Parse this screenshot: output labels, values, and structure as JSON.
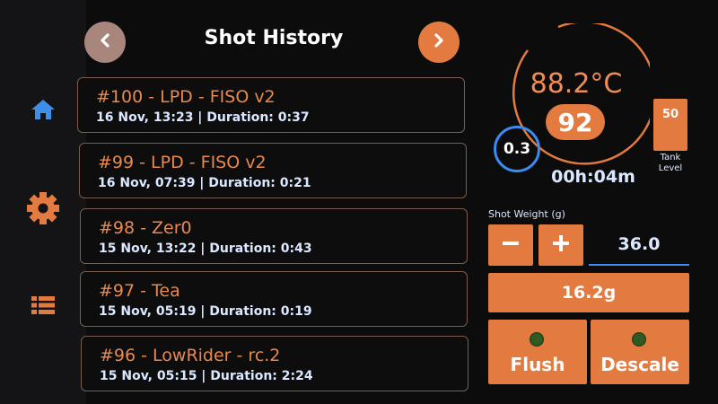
{
  "header": {
    "title": "Shot History"
  },
  "sidebar": {
    "items": [
      {
        "icon": "home-icon"
      },
      {
        "icon": "gear-icon"
      },
      {
        "icon": "list-icon"
      }
    ]
  },
  "shots": [
    {
      "name": "#100 - LPD - FISO v2",
      "meta": "16 Nov, 13:23 | Duration: 0:37"
    },
    {
      "name": "#99 - LPD - FISO v2",
      "meta": "16 Nov, 07:39 | Duration: 0:21"
    },
    {
      "name": "#98 - Zer0",
      "meta": "15 Nov, 13:22 | Duration: 0:43"
    },
    {
      "name": "#97 - Tea",
      "meta": "15 Nov, 05:19 | Duration: 0:19"
    },
    {
      "name": "#96 - LowRider - rc.2",
      "meta": "15 Nov, 05:15 | Duration: 2:24"
    }
  ],
  "status": {
    "temperature": "88.2°C",
    "target_temp": "92",
    "pressure": "0.3",
    "timer": "00h:04m",
    "tank_level": "50",
    "tank_label": "Tank Level"
  },
  "weight": {
    "label": "Shot Weight (g)",
    "value": "36.0",
    "scale_reading": "16.2g"
  },
  "actions": {
    "flush_label": "Flush",
    "descale_label": "Descale"
  },
  "colors": {
    "accent": "#e37a3f",
    "text_orange": "#e8894f",
    "blue": "#3b8cf2",
    "background": "#0c0c0d"
  }
}
